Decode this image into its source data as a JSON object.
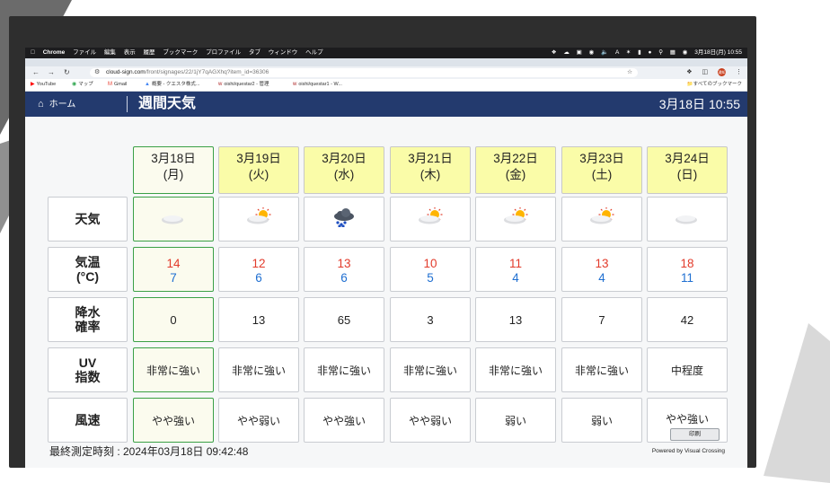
{
  "menubar": {
    "app": "Chrome",
    "menus": [
      "ファイル",
      "編集",
      "表示",
      "履歴",
      "ブックマーク",
      "プロファイル",
      "タブ",
      "ウィンドウ",
      "ヘルプ"
    ],
    "clock": "3月18日(月) 10:55"
  },
  "browser": {
    "url_host": "cloud-sign.com",
    "url_path": "/front/signages/22/1jY7qAGXhq?item_id=36306",
    "bookmarks": [
      "YouTube",
      "マップ",
      "Gmail",
      "概要 - クエスタ株式...",
      "oishi/questar2 - 管理",
      "oishi/questar1 - W..."
    ],
    "all_bookmarks": "すべてのブックマーク",
    "profile_initials": "通知"
  },
  "header": {
    "home": "ホーム",
    "title": "週間天気",
    "datetime": "3月18日 10:55"
  },
  "row_labels": {
    "weather": "天気",
    "temp_l1": "気温",
    "temp_l2": "(°C)",
    "precip_l1": "降水",
    "precip_l2": "確率",
    "uv_l1": "UV",
    "uv_l2": "指数",
    "wind": "風速"
  },
  "days": [
    {
      "date": "3月18日",
      "dow": "(月)",
      "weather": "cloudy",
      "high": "14",
      "low": "7",
      "precip": "0",
      "uv": "非常に強い",
      "wind": "やや強い",
      "today": true
    },
    {
      "date": "3月19日",
      "dow": "(火)",
      "weather": "sun-behind-cloud",
      "high": "12",
      "low": "6",
      "precip": "13",
      "uv": "非常に強い",
      "wind": "やや弱い",
      "today": false
    },
    {
      "date": "3月20日",
      "dow": "(水)",
      "weather": "cloud-rain",
      "high": "13",
      "low": "6",
      "precip": "65",
      "uv": "非常に強い",
      "wind": "やや強い",
      "today": false
    },
    {
      "date": "3月21日",
      "dow": "(木)",
      "weather": "sun-behind-cloud",
      "high": "10",
      "low": "5",
      "precip": "3",
      "uv": "非常に強い",
      "wind": "やや弱い",
      "today": false
    },
    {
      "date": "3月22日",
      "dow": "(金)",
      "weather": "sun-behind-cloud",
      "high": "11",
      "low": "4",
      "precip": "13",
      "uv": "非常に強い",
      "wind": "弱い",
      "today": false
    },
    {
      "date": "3月23日",
      "dow": "(土)",
      "weather": "sun-behind-cloud",
      "high": "13",
      "low": "4",
      "precip": "7",
      "uv": "非常に強い",
      "wind": "弱い",
      "today": false
    },
    {
      "date": "3月24日",
      "dow": "(日)",
      "weather": "cloudy",
      "high": "18",
      "low": "11",
      "precip": "42",
      "uv": "中程度",
      "wind": "やや強い",
      "today": false
    }
  ],
  "print_label": "印刷",
  "footer": {
    "measured": "最終測定時刻 : 2024年03月18日 09:42:48",
    "powered": "Powered by Visual Crossing"
  },
  "colors": {
    "header_bg": "#233a6e",
    "date_bg": "#fafca8",
    "today_border": "#3aa046",
    "high_temp": "#e23b2b",
    "low_temp": "#1f6fd1"
  }
}
